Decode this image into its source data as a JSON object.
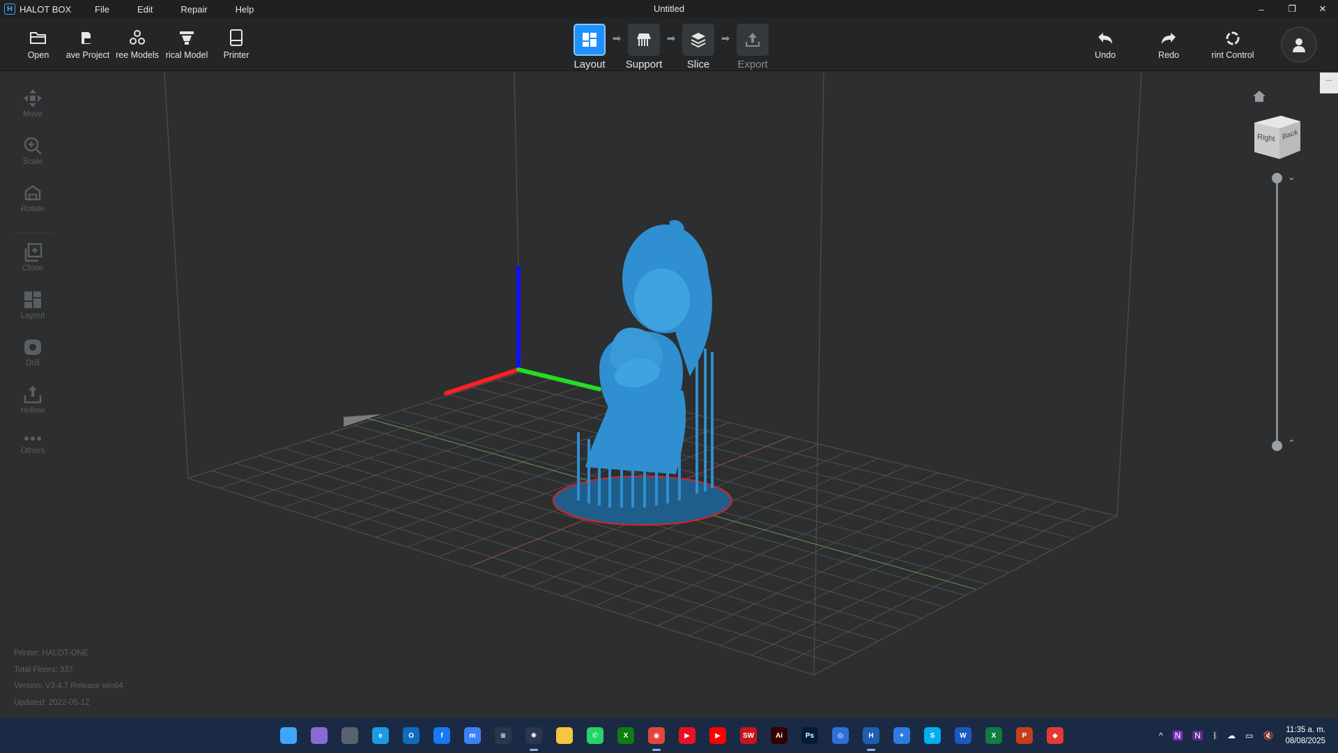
{
  "app": {
    "logo_letter": "H",
    "name": "HALOT BOX",
    "window_title": "Untitled"
  },
  "menu": [
    "File",
    "Edit",
    "Repair",
    "Help"
  ],
  "window_controls": {
    "minimize": "–",
    "restore": "❐",
    "close": "✕"
  },
  "toolbar": {
    "left": [
      {
        "label": "Open",
        "icon": "folder-open-icon"
      },
      {
        "label": "ave Project",
        "icon": "save-project-icon"
      },
      {
        "label": "ree Models",
        "icon": "free-models-icon"
      },
      {
        "label": "rical Model",
        "icon": "historical-model-icon"
      },
      {
        "label": "Printer",
        "icon": "printer-icon"
      }
    ],
    "steps": [
      {
        "label": "Layout",
        "state": "active",
        "icon": "layout-icon"
      },
      {
        "label": "Support",
        "state": "normal",
        "icon": "support-icon"
      },
      {
        "label": "Slice",
        "state": "normal",
        "icon": "slice-icon"
      },
      {
        "label": "Export",
        "state": "dim",
        "icon": "export-icon"
      }
    ],
    "right": [
      {
        "label": "Undo",
        "icon": "undo-icon"
      },
      {
        "label": "Redo",
        "icon": "redo-icon"
      },
      {
        "label": "rint Control",
        "icon": "print-control-icon"
      }
    ]
  },
  "left_tools": [
    {
      "label": "Move",
      "icon": "move-icon"
    },
    {
      "label": "Scale",
      "icon": "scale-icon"
    },
    {
      "label": "Rotate",
      "icon": "rotate-icon"
    },
    {
      "label": "Clone",
      "icon": "clone-icon"
    },
    {
      "label": "Layout",
      "icon": "layout-tool-icon"
    },
    {
      "label": "Drill",
      "icon": "drill-icon"
    },
    {
      "label": "Hollow",
      "icon": "hollow-icon"
    },
    {
      "label": "Others",
      "icon": "more-icon"
    }
  ],
  "view_cube": {
    "right_face": "Right",
    "back_face": "Back"
  },
  "info": {
    "printer": "Printer: HALOT-ONE",
    "floors": "Total Floors: 337",
    "version": "Version: V3.4.7 Release win64",
    "updated": "Updated:  2022-05-12"
  },
  "side_tab": "...",
  "colors": {
    "accent": "#1e90ff",
    "model": "#2f8fd0",
    "axis_x": "#ff2020",
    "axis_y": "#20e020",
    "axis_z": "#1010ff"
  },
  "taskbar": {
    "apps": [
      {
        "name": "windows-start-icon",
        "text": "",
        "color": "#3ea6ff"
      },
      {
        "name": "files-icon",
        "text": "",
        "color": "#8a6bd6"
      },
      {
        "name": "calculator-icon",
        "text": "",
        "color": "#5a6270"
      },
      {
        "name": "edge-icon",
        "text": "e",
        "color": "#1c9be6"
      },
      {
        "name": "outlook-icon",
        "text": "O",
        "color": "#0f6cbd"
      },
      {
        "name": "facebook-icon",
        "text": "f",
        "color": "#1877f2"
      },
      {
        "name": "messenger-icon",
        "text": "m",
        "color": "#3b82f6"
      },
      {
        "name": "app-s-icon",
        "text": "≋",
        "color": "#2a3550"
      },
      {
        "name": "chatgpt-icon",
        "text": "✺",
        "color": "#2a3550"
      },
      {
        "name": "file-explorer-icon",
        "text": "",
        "color": "#f5c542"
      },
      {
        "name": "whatsapp-icon",
        "text": "✆",
        "color": "#25d366"
      },
      {
        "name": "xbox-icon",
        "text": "X",
        "color": "#107c10"
      },
      {
        "name": "chrome-icon",
        "text": "◉",
        "color": "#e3453a"
      },
      {
        "name": "media-player-icon",
        "text": "▶",
        "color": "#e81123"
      },
      {
        "name": "youtube-icon",
        "text": "▶",
        "color": "#ff0000"
      },
      {
        "name": "solidworks-icon",
        "text": "SW",
        "color": "#c4161c"
      },
      {
        "name": "illustrator-icon",
        "text": "Ai",
        "color": "#330000"
      },
      {
        "name": "photoshop-icon",
        "text": "Ps",
        "color": "#001e36"
      },
      {
        "name": "app-ring-icon",
        "text": "◎",
        "color": "#2f6fd6"
      },
      {
        "name": "halot-box-icon",
        "text": "H",
        "color": "#1e5fb0"
      },
      {
        "name": "app-blue-icon",
        "text": "✦",
        "color": "#2d7be0"
      },
      {
        "name": "skype-icon",
        "text": "S",
        "color": "#00aff0"
      },
      {
        "name": "word-icon",
        "text": "W",
        "color": "#185abd"
      },
      {
        "name": "excel-icon",
        "text": "X",
        "color": "#107c41"
      },
      {
        "name": "powerpoint-icon",
        "text": "P",
        "color": "#c43e1c"
      },
      {
        "name": "app-red-icon",
        "text": "◆",
        "color": "#e53935"
      }
    ],
    "tray": [
      "^",
      "N",
      "N",
      "ᛒ",
      "☁",
      "▭",
      "🔇"
    ],
    "time": "11:35 a. m.",
    "date": "08/08/2025"
  }
}
